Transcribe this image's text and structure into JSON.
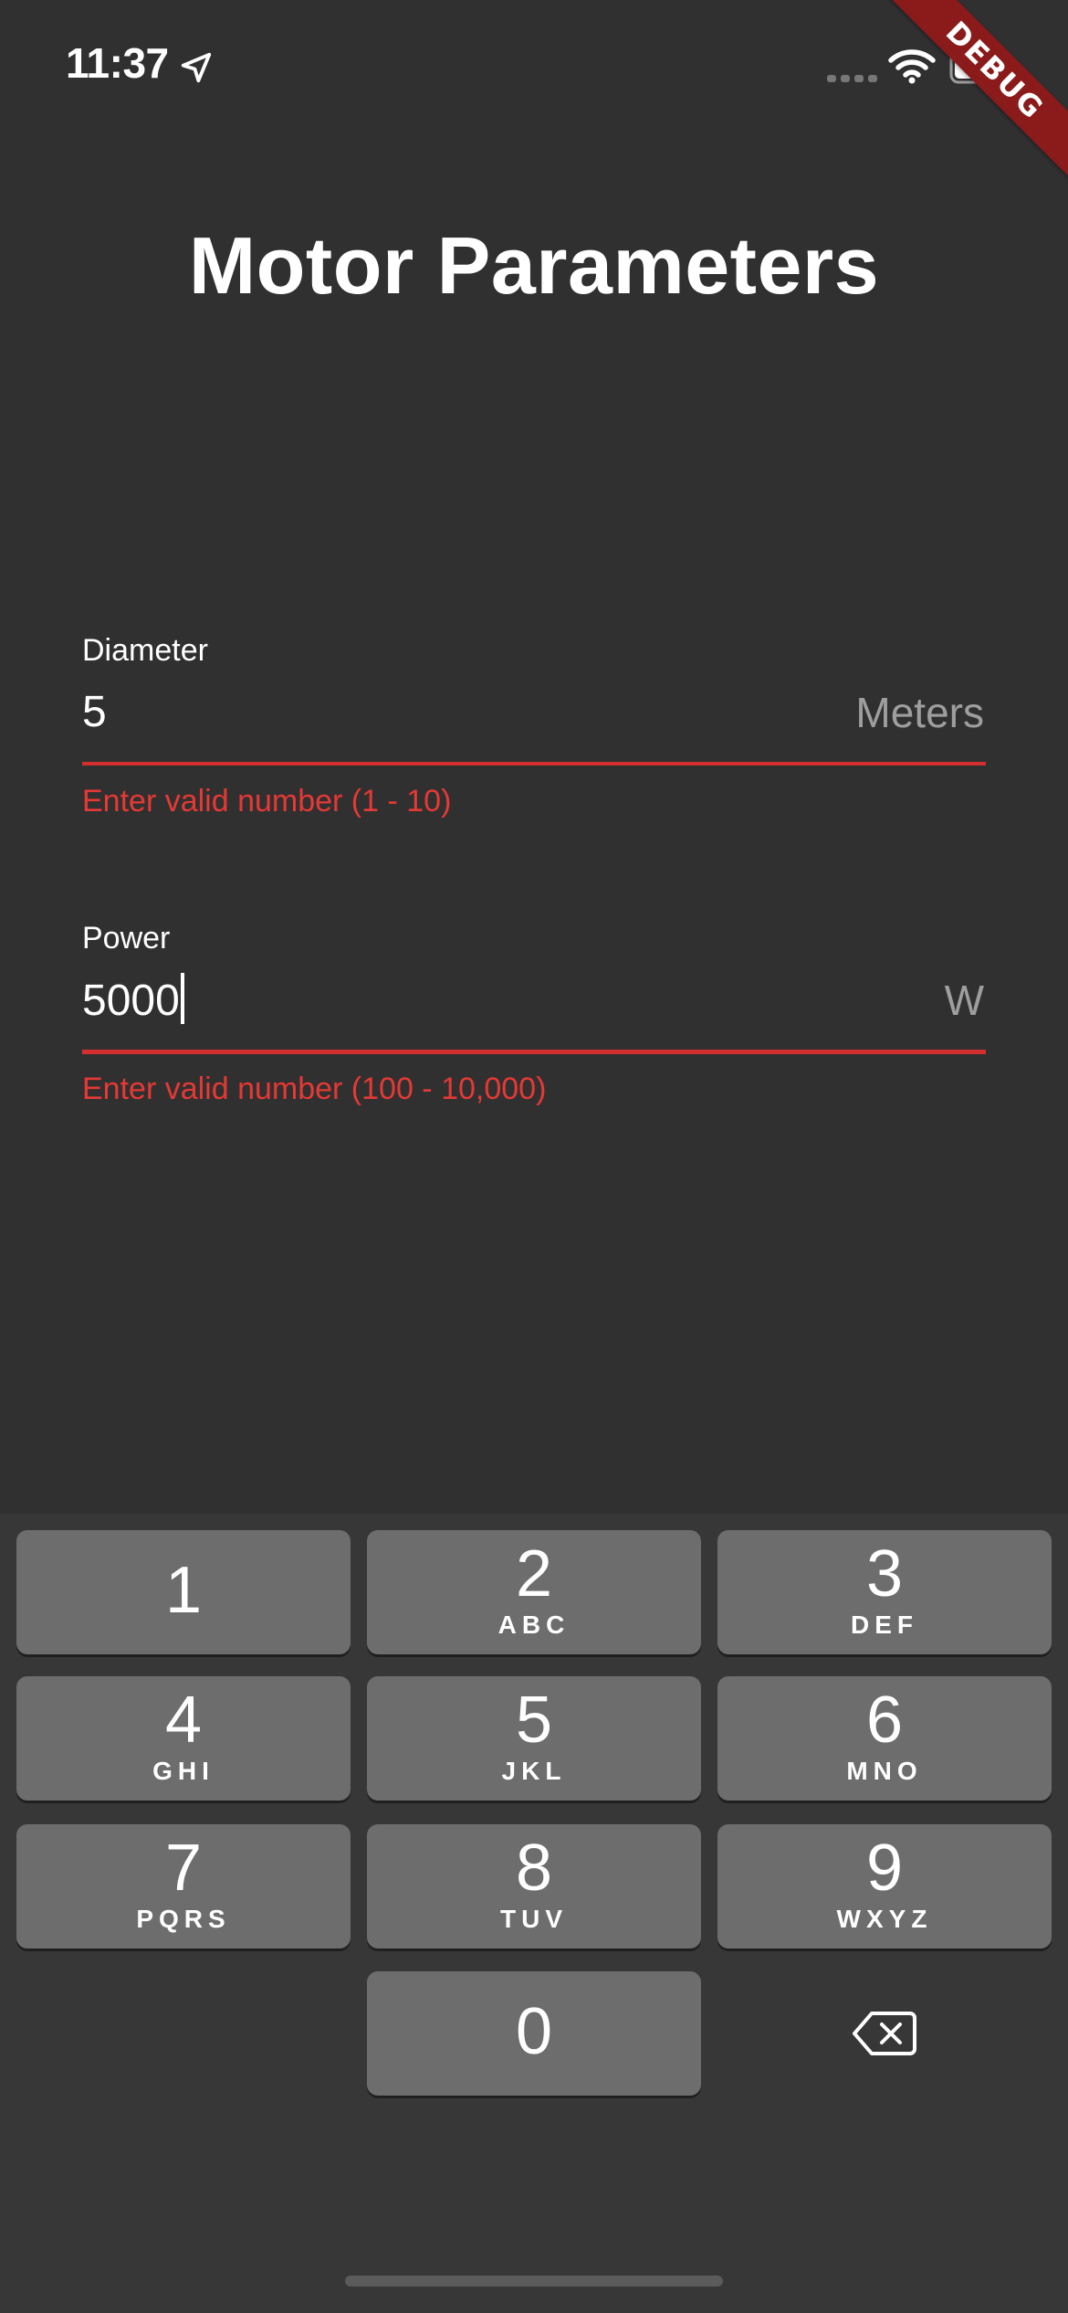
{
  "status_bar": {
    "time": "11:37",
    "icons": [
      "location-arrow-icon",
      "cellular-signal-icon",
      "wifi-icon",
      "battery-icon"
    ]
  },
  "debug_banner": {
    "label": "DEBUG",
    "color": "#8b1a1a"
  },
  "page": {
    "title": "Motor Parameters"
  },
  "form": {
    "diameter": {
      "label": "Diameter",
      "value": "5",
      "suffix": "Meters",
      "error": "Enter valid number (1 - 10)"
    },
    "power": {
      "label": "Power",
      "value": "5000",
      "suffix": "W",
      "error": "Enter valid number (100 - 10,000)"
    }
  },
  "keyboard": {
    "keys": [
      {
        "digit": "1",
        "letters": ""
      },
      {
        "digit": "2",
        "letters": "ABC"
      },
      {
        "digit": "3",
        "letters": "DEF"
      },
      {
        "digit": "4",
        "letters": "GHI"
      },
      {
        "digit": "5",
        "letters": "JKL"
      },
      {
        "digit": "6",
        "letters": "MNO"
      },
      {
        "digit": "7",
        "letters": "PQRS"
      },
      {
        "digit": "8",
        "letters": "TUV"
      },
      {
        "digit": "9",
        "letters": "WXYZ"
      },
      {
        "digit": "0",
        "letters": ""
      }
    ],
    "delete_icon": "delete-backspace-icon"
  },
  "colors": {
    "background": "#303030",
    "error": "#e53935",
    "underline_error": "#d32f2f",
    "key": "#6d6d6d",
    "keyboard_bg": "#373737"
  }
}
